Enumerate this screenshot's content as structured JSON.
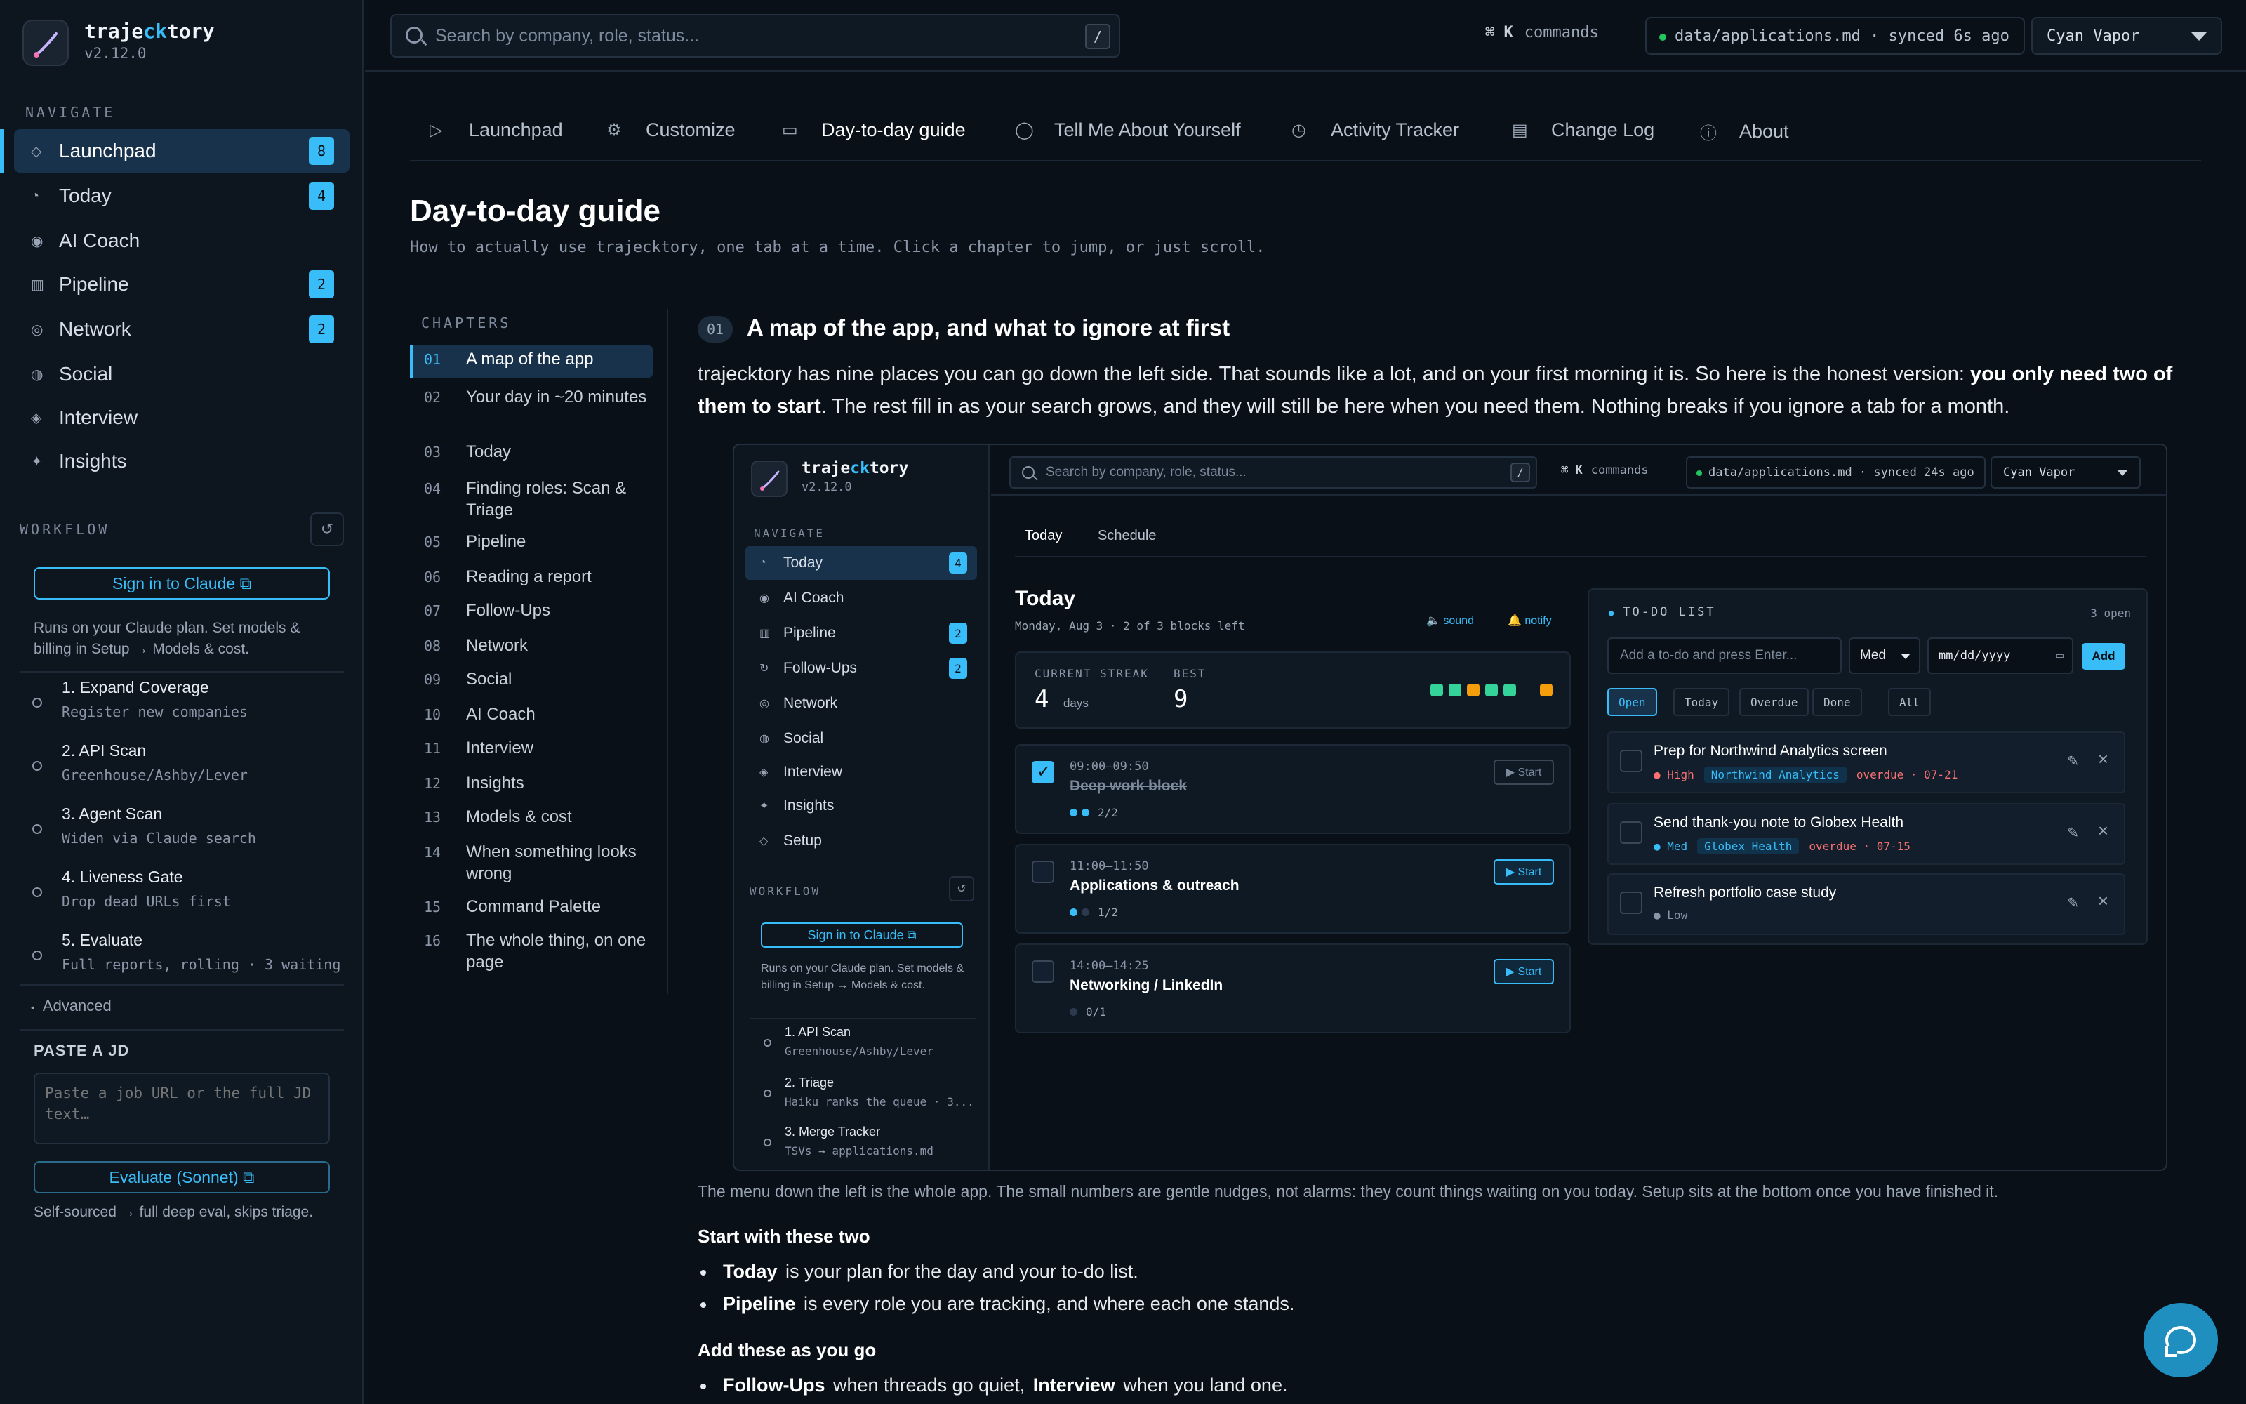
{
  "app": {
    "name_prefix": "traje",
    "name_accent": "ck",
    "name_suffix": "tory",
    "version": "v2.12.0"
  },
  "sidebar": {
    "navigate_label": "NAVIGATE",
    "items": [
      {
        "label": "Launchpad",
        "icon": "diamond-icon",
        "glyph": "◇",
        "badge": "8",
        "active": true
      },
      {
        "label": "Today",
        "icon": "clock-icon",
        "glyph": "◔",
        "badge": "4"
      },
      {
        "label": "AI Coach",
        "icon": "target-icon",
        "glyph": "◉",
        "badge": ""
      },
      {
        "label": "Pipeline",
        "icon": "grid-icon",
        "glyph": "▥",
        "badge": "2"
      },
      {
        "label": "Network",
        "icon": "network-icon",
        "glyph": "◎",
        "badge": "2"
      },
      {
        "label": "Social",
        "icon": "globe-icon",
        "glyph": "◍",
        "badge": ""
      },
      {
        "label": "Interview",
        "icon": "interview-icon",
        "glyph": "◈",
        "badge": ""
      },
      {
        "label": "Insights",
        "icon": "sparkle-icon",
        "glyph": "✦",
        "badge": ""
      }
    ],
    "workflow_label": "WORKFLOW",
    "signin_label": "Sign in to Claude ⧉",
    "plan_note": "Runs on your Claude plan. Set models & billing in Setup → Models & cost.",
    "steps": [
      {
        "title": "1. Expand Coverage",
        "sub": "Register new companies"
      },
      {
        "title": "2. API Scan",
        "sub": "Greenhouse/Ashby/Lever"
      },
      {
        "title": "3. Agent Scan",
        "sub": "Widen via Claude search"
      },
      {
        "title": "4. Liveness Gate",
        "sub": "Drop dead URLs first"
      },
      {
        "title": "5. Evaluate",
        "sub": "Full reports, rolling · 3 waiting"
      }
    ],
    "advanced_label": "Advanced",
    "paste_label": "PASTE A JD",
    "paste_placeholder": "Paste a job URL or the full JD text…",
    "evaluate_label": "Evaluate (Sonnet) ⧉",
    "evaluate_note": "Self-sourced → full deep eval, skips triage."
  },
  "topbar": {
    "search_placeholder": "Search by company, role, status...",
    "search_key": "/",
    "cmd_key": "⌘ K",
    "cmd_label": "commands",
    "sync_text": "data/applications.md · synced 6s ago",
    "theme": "Cyan Vapor"
  },
  "tabs": [
    {
      "label": "Launchpad",
      "icon": "play-icon",
      "glyph": "▷"
    },
    {
      "label": "Customize",
      "icon": "gear-icon",
      "glyph": "⚙"
    },
    {
      "label": "Day-to-day guide",
      "icon": "book-icon",
      "glyph": "▭",
      "active": true
    },
    {
      "label": "Tell Me About Yourself",
      "icon": "chat-icon",
      "glyph": "◯"
    },
    {
      "label": "Activity Tracker",
      "icon": "clock-icon",
      "glyph": "◷"
    },
    {
      "label": "Change Log",
      "icon": "file-icon",
      "glyph": "▤"
    },
    {
      "label": "About",
      "icon": "info-icon",
      "glyph": "ⓘ"
    }
  ],
  "page": {
    "title": "Day-to-day guide",
    "subtitle": "How to actually use trajecktory, one tab at a time. Click a chapter to jump, or just scroll.",
    "chapters_label": "CHAPTERS",
    "chapters": [
      {
        "num": "01",
        "label": "A map of the app"
      },
      {
        "num": "02",
        "label": "Your day in ~20 minutes"
      },
      {
        "num": "03",
        "label": "Today"
      },
      {
        "num": "04",
        "label": "Finding roles: Scan & Triage"
      },
      {
        "num": "05",
        "label": "Pipeline"
      },
      {
        "num": "06",
        "label": "Reading a report"
      },
      {
        "num": "07",
        "label": "Follow-Ups"
      },
      {
        "num": "08",
        "label": "Network"
      },
      {
        "num": "09",
        "label": "Social"
      },
      {
        "num": "10",
        "label": "AI Coach"
      },
      {
        "num": "11",
        "label": "Interview"
      },
      {
        "num": "12",
        "label": "Insights"
      },
      {
        "num": "13",
        "label": "Models & cost"
      },
      {
        "num": "14",
        "label": "When something looks wrong"
      },
      {
        "num": "15",
        "label": "Command Palette"
      },
      {
        "num": "16",
        "label": "The whole thing, on one page"
      }
    ],
    "section_num": "01",
    "section_title": "A map of the app, and what to ignore at first",
    "intro_a": "trajecktory has nine places you can go down the left side. That sounds like a lot, and on your first morning it is. So here is the honest version: ",
    "intro_b": "you only need two of them to start",
    "intro_c": ". The rest fill in as your search grows, and they will still be here when you need them. Nothing breaks if you ignore a tab for a month.",
    "caption": "The menu down the left is the whole app. The small numbers are gentle nudges, not alarms: they count things waiting on you today. Setup sits at the bottom once you have finished it.",
    "start_heading": "Start with these two",
    "start_items": [
      {
        "bold": "Today",
        "text": "is your plan for the day and your to-do list."
      },
      {
        "bold": "Pipeline",
        "text": "is every role you are tracking, and where each one stands."
      }
    ],
    "add_heading": "Add these as you go",
    "add_items": [
      {
        "bold": "Follow-Ups",
        "text": "when threads go quiet,",
        "bold2": "Interview",
        "text2": "when you land one."
      }
    ]
  },
  "preview": {
    "navigate_label": "NAVIGATE",
    "nav": [
      {
        "label": "Today",
        "glyph": "◔",
        "badge": "4",
        "active": true
      },
      {
        "label": "AI Coach",
        "glyph": "◉",
        "badge": ""
      },
      {
        "label": "Pipeline",
        "glyph": "▥",
        "badge": "2"
      },
      {
        "label": "Follow-Ups",
        "glyph": "↻",
        "badge": "2"
      },
      {
        "label": "Network",
        "glyph": "◎",
        "badge": ""
      },
      {
        "label": "Social",
        "glyph": "◍",
        "badge": ""
      },
      {
        "label": "Interview",
        "glyph": "◈",
        "badge": ""
      },
      {
        "label": "Insights",
        "glyph": "✦",
        "badge": ""
      },
      {
        "label": "Setup",
        "glyph": "◇",
        "badge": ""
      }
    ],
    "workflow_label": "WORKFLOW",
    "signin_label": "Sign in to Claude ⧉",
    "plan_note": "Runs on your Claude plan. Set models & billing in Setup → Models & cost.",
    "steps": [
      {
        "title": "1. API Scan",
        "sub": "Greenhouse/Ashby/Lever"
      },
      {
        "title": "2. Triage",
        "sub": "Haiku ranks the queue · 3..."
      },
      {
        "title": "3. Merge Tracker",
        "sub": "TSVs → applications.md"
      }
    ],
    "search_placeholder": "Search by company, role, status...",
    "search_key": "/",
    "cmd_key": "⌘ K",
    "cmd_label": "commands",
    "sync_text": "data/applications.md · synced 24s ago",
    "theme": "Cyan Vapor",
    "tabs": [
      "Today",
      "Schedule"
    ],
    "heading": "Today",
    "date": "Monday, Aug 3 · 2 of 3 blocks left",
    "sound": "🔈 sound",
    "notify": "🔔 notify",
    "streak_label": "CURRENT STREAK",
    "streak_value": "4",
    "streak_unit": "days",
    "best_label": "BEST",
    "best_value": "9",
    "streak_squares": [
      "#34d399",
      "#34d399",
      "#f59e0b",
      "#34d399",
      "#34d399",
      "#0f1923",
      "#f59e0b"
    ],
    "blocks": [
      {
        "time": "09:00–09:50",
        "title": "Deep work block",
        "progress": "2/2",
        "done": true,
        "start": "▶ Start",
        "dots": [
          "#38bdf8",
          "#38bdf8"
        ]
      },
      {
        "time": "11:00–11:50",
        "title": "Applications & outreach",
        "progress": "1/2",
        "done": false,
        "start": "▶ Start",
        "dots": [
          "#38bdf8",
          "#2b3a4c"
        ]
      },
      {
        "time": "14:00–14:25",
        "title": "Networking / LinkedIn",
        "progress": "0/1",
        "done": false,
        "start": "▶ Start",
        "dots": [
          "#2b3a4c"
        ]
      }
    ],
    "todo": {
      "label": "TO-DO LIST",
      "open_count": "3 open",
      "input_placeholder": "Add a to-do and press Enter...",
      "priority": "Med",
      "date_placeholder": "mm/dd/yyyy",
      "add_label": "Add",
      "filters": [
        "Open",
        "Today",
        "Overdue",
        "Done",
        "All"
      ],
      "items": [
        {
          "title": "Prep for Northwind Analytics screen",
          "priority": "High",
          "priority_color": "#f87171",
          "company": "Northwind Analytics",
          "due": "overdue · 07-21"
        },
        {
          "title": "Send thank-you note to Globex Health",
          "priority": "Med",
          "priority_color": "#38bdf8",
          "company": "Globex Health",
          "due": "overdue · 07-15"
        },
        {
          "title": "Refresh portfolio case study",
          "priority": "Low",
          "priority_color": "#8a96a8",
          "company": "",
          "due": ""
        }
      ]
    }
  },
  "colors": {
    "accent": "#38bdf8",
    "background": "#0a1017",
    "overdue": "#f87171"
  }
}
